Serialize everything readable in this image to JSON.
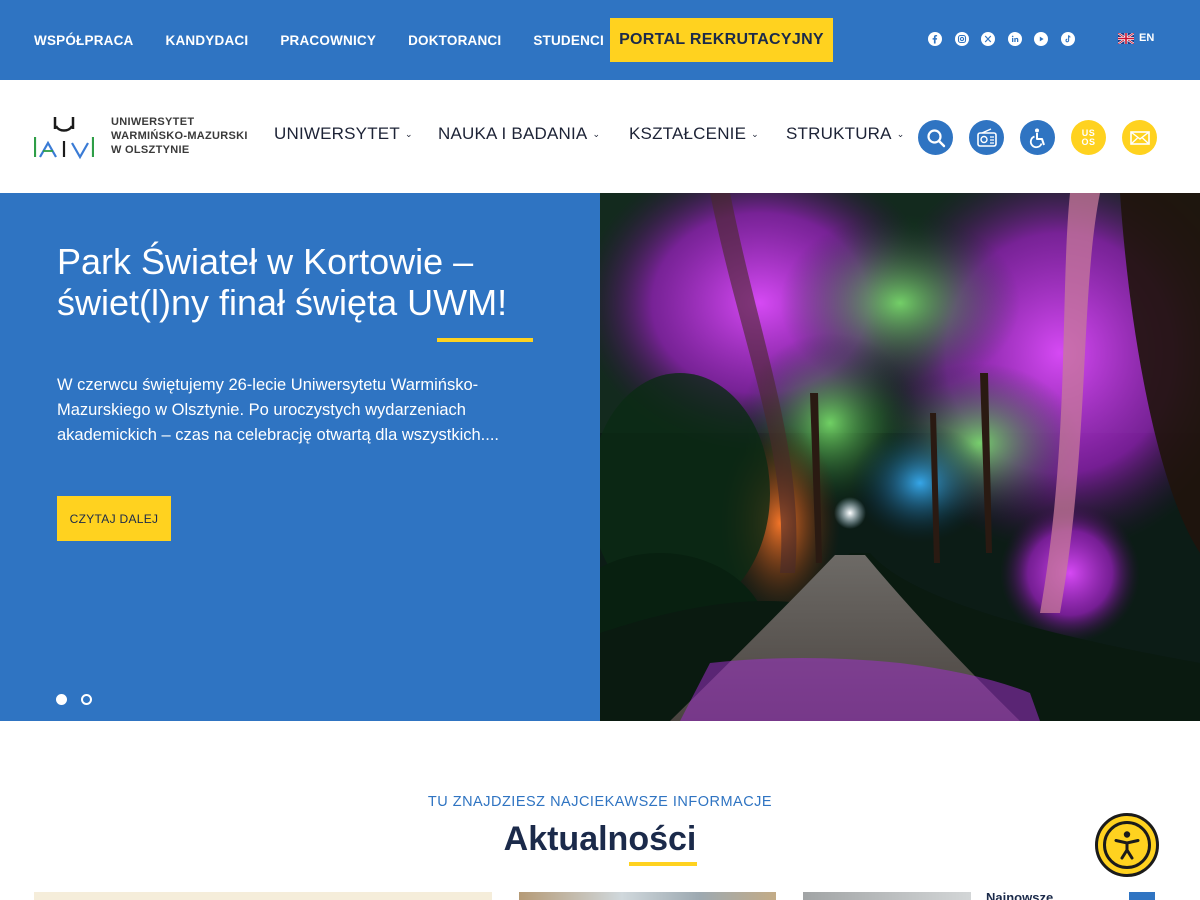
{
  "topbar": {
    "nav": [
      "WSPÓŁPRACA",
      "KANDYDACI",
      "PRACOWNICY",
      "DOKTORANCI",
      "STUDENCI"
    ],
    "portal_label": "PORTAL REKRUTACYJNY",
    "social_icons": [
      "facebook-icon",
      "instagram-icon",
      "x-icon",
      "linkedin-icon",
      "youtube-icon",
      "tiktok-icon"
    ],
    "language": "EN"
  },
  "header": {
    "logo_lines": [
      "UNIWERSYTET",
      "WARMIŃSKO-MAZURSKI",
      "W OLSZTYNIE"
    ],
    "nav": [
      "UNIWERSYTET",
      "NAUKA I BADANIA",
      "KSZTAŁCENIE",
      "STRUKTURA"
    ],
    "usos_label": [
      "US",
      "OS"
    ],
    "icons": [
      "search-icon",
      "radio-icon",
      "accessibility-icon",
      "usos-icon",
      "mail-icon"
    ]
  },
  "hero": {
    "title": "Park Świateł w Kortowie – świet(l)ny finał święta UWM!",
    "text": "W czerwcu świętujemy 26-lecie Uniwersytetu Warmińsko-Mazurskiego w Olsztynie. Po uroczystych wydarzeniach akademickich – czas na celebrację otwartą dla wszystkich....",
    "button_label": "CZYTAJ DALEJ",
    "slide_count": 2,
    "active_slide": 1
  },
  "news": {
    "kicker": "TU ZNAJDZIESZ NAJCIEKAWSZE INFORMACJE",
    "title": "Aktualności",
    "card4_title": "Najnowsze"
  },
  "colors": {
    "primary_blue": "#2f74c2",
    "accent_yellow": "#ffd21f",
    "navy": "#1b2a4a"
  }
}
